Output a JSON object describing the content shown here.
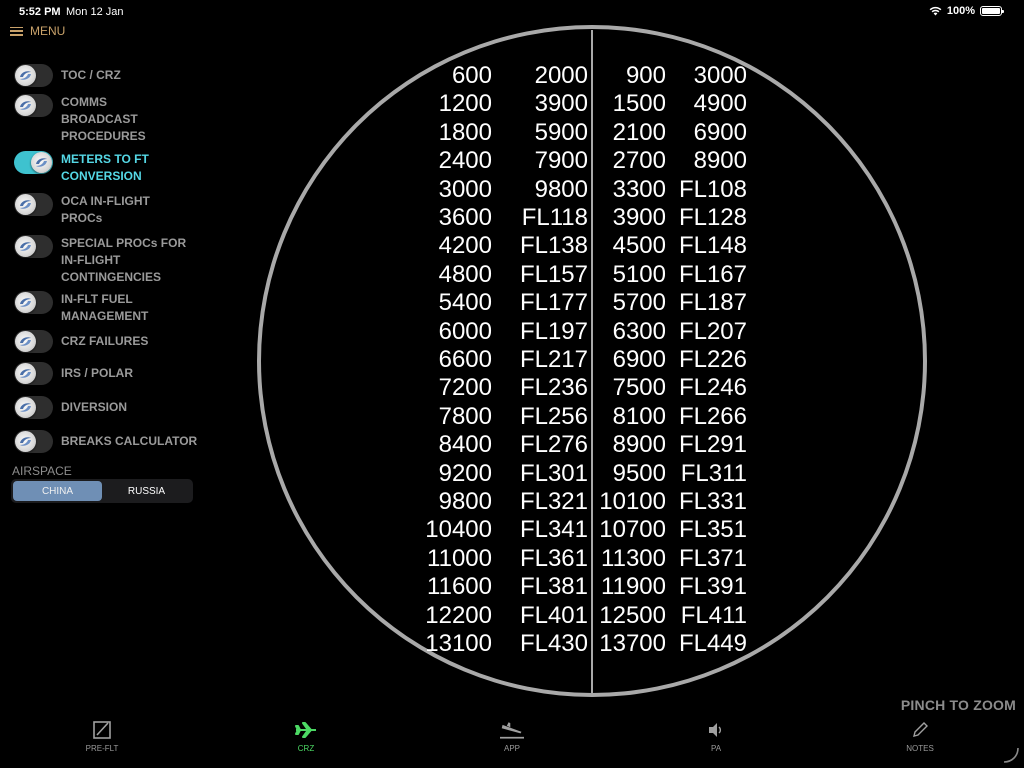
{
  "status_bar": {
    "time": "5:52 PM",
    "date": "Mon 12 Jan",
    "battery": "100%"
  },
  "menu": {
    "label": "MENU"
  },
  "sidebar": {
    "items": [
      {
        "label": "TOC / CRZ",
        "on": false
      },
      {
        "label": "COMMS BROADCAST PROCEDURES",
        "on": false
      },
      {
        "label": "METERS TO FT CONVERSION",
        "on": true
      },
      {
        "label": "OCA IN-FLIGHT PROCs",
        "on": false
      },
      {
        "label": "SPECIAL PROCs FOR IN-FLIGHT CONTINGENCIES",
        "on": false
      },
      {
        "label": "IN-FLT FUEL MANAGEMENT",
        "on": false
      },
      {
        "label": "CRZ FAILURES",
        "on": false
      },
      {
        "label": "IRS / POLAR",
        "on": false
      },
      {
        "label": "DIVERSION",
        "on": false
      },
      {
        "label": "BREAKS CALCULATOR",
        "on": false
      }
    ],
    "airspace": {
      "label": "AIRSPACE",
      "options": [
        "CHINA",
        "RUSSIA"
      ],
      "selected": "CHINA"
    }
  },
  "chart": {
    "rows": [
      [
        "600",
        "2000",
        "900",
        "3000"
      ],
      [
        "1200",
        "3900",
        "1500",
        "4900"
      ],
      [
        "1800",
        "5900",
        "2100",
        "6900"
      ],
      [
        "2400",
        "7900",
        "2700",
        "8900"
      ],
      [
        "3000",
        "9800",
        "3300",
        "FL108"
      ],
      [
        "3600",
        "FL118",
        "3900",
        "FL128"
      ],
      [
        "4200",
        "FL138",
        "4500",
        "FL148"
      ],
      [
        "4800",
        "FL157",
        "5100",
        "FL167"
      ],
      [
        "5400",
        "FL177",
        "5700",
        "FL187"
      ],
      [
        "6000",
        "FL197",
        "6300",
        "FL207"
      ],
      [
        "6600",
        "FL217",
        "6900",
        "FL226"
      ],
      [
        "7200",
        "FL236",
        "7500",
        "FL246"
      ],
      [
        "7800",
        "FL256",
        "8100",
        "FL266"
      ],
      [
        "8400",
        "FL276",
        "8900",
        "FL291"
      ],
      [
        "9200",
        "FL301",
        "9500",
        "FL311"
      ],
      [
        "9800",
        "FL321",
        "10100",
        "FL331"
      ],
      [
        "10400",
        "FL341",
        "10700",
        "FL351"
      ],
      [
        "11000",
        "FL361",
        "11300",
        "FL371"
      ],
      [
        "11600",
        "FL381",
        "11900",
        "FL391"
      ],
      [
        "12200",
        "FL401",
        "12500",
        "FL411"
      ],
      [
        "13100",
        "FL430",
        "13700",
        "FL449"
      ]
    ],
    "hint": "PINCH TO ZOOM"
  },
  "tabs": [
    {
      "label": "PRE-FLT",
      "icon": "checklist-icon"
    },
    {
      "label": "CRZ",
      "icon": "airplane-icon",
      "active": true
    },
    {
      "label": "APP",
      "icon": "landing-icon"
    },
    {
      "label": "PA",
      "icon": "speaker-icon"
    },
    {
      "label": "NOTES",
      "icon": "pencil-icon"
    }
  ],
  "colors": {
    "accent": "#55d8e6",
    "toggle_on": "#3ec2cf",
    "menu": "#c9a26a",
    "tab_active": "#4cd964",
    "segment_selected": "#6f8fb5"
  }
}
